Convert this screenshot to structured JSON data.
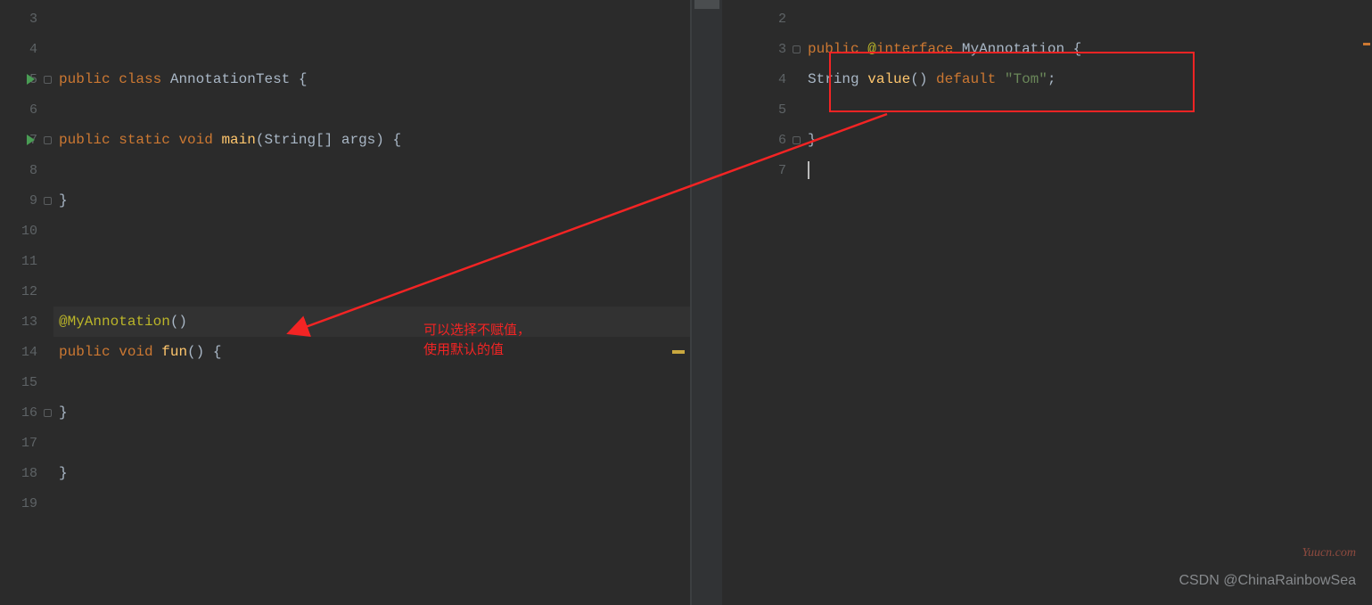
{
  "leftPane": {
    "lines": [
      {
        "num": "3",
        "run": false,
        "fold": false
      },
      {
        "num": "4",
        "run": false,
        "fold": false
      },
      {
        "num": "5",
        "run": true,
        "fold": true
      },
      {
        "num": "6",
        "run": false,
        "fold": false
      },
      {
        "num": "7",
        "run": true,
        "fold": true
      },
      {
        "num": "8",
        "run": false,
        "fold": false
      },
      {
        "num": "9",
        "run": false,
        "fold": true
      },
      {
        "num": "10",
        "run": false,
        "fold": false
      },
      {
        "num": "11",
        "run": false,
        "fold": false
      },
      {
        "num": "12",
        "run": false,
        "fold": false
      },
      {
        "num": "13",
        "run": false,
        "fold": false
      },
      {
        "num": "14",
        "run": false,
        "fold": false
      },
      {
        "num": "15",
        "run": false,
        "fold": false
      },
      {
        "num": "16",
        "run": false,
        "fold": true
      },
      {
        "num": "17",
        "run": false,
        "fold": false
      },
      {
        "num": "18",
        "run": false,
        "fold": false
      },
      {
        "num": "19",
        "run": false,
        "fold": false
      }
    ],
    "code": {
      "l5": {
        "public": "public",
        "class": "class",
        "name": "AnnotationTest",
        "brace": " {"
      },
      "l7": {
        "public": "public",
        "static": "static",
        "void": "void",
        "main": "main",
        "sig": "(String[] args) {"
      },
      "l9": {
        "brace": "}"
      },
      "l13": {
        "anno": "@MyAnnotation",
        "paren": "()"
      },
      "l14": {
        "public": "public",
        "void": "void",
        "fun": "fun",
        "sig": "() {"
      },
      "l16": {
        "brace": "}"
      },
      "l18": {
        "brace": "}"
      }
    }
  },
  "rightPane": {
    "lines": [
      {
        "num": "2"
      },
      {
        "num": "3"
      },
      {
        "num": "4"
      },
      {
        "num": "5"
      },
      {
        "num": "6"
      },
      {
        "num": "7"
      }
    ],
    "code": {
      "l3": {
        "public": "public",
        "at": "@",
        "interface": "interface",
        "name": "MyAnnotation",
        "brace": " {"
      },
      "l4": {
        "type": "String",
        "method": "value",
        "paren": "()",
        "default": "default",
        "str": "\"Tom\"",
        "semi": ";"
      },
      "l6": {
        "brace": "}"
      }
    }
  },
  "annotation": {
    "line1": "可以选择不赋值，",
    "line2": "使用默认的值"
  },
  "watermarks": {
    "w1": "Yuucn.com",
    "w2": "CSDN @ChinaRainbowSea"
  }
}
